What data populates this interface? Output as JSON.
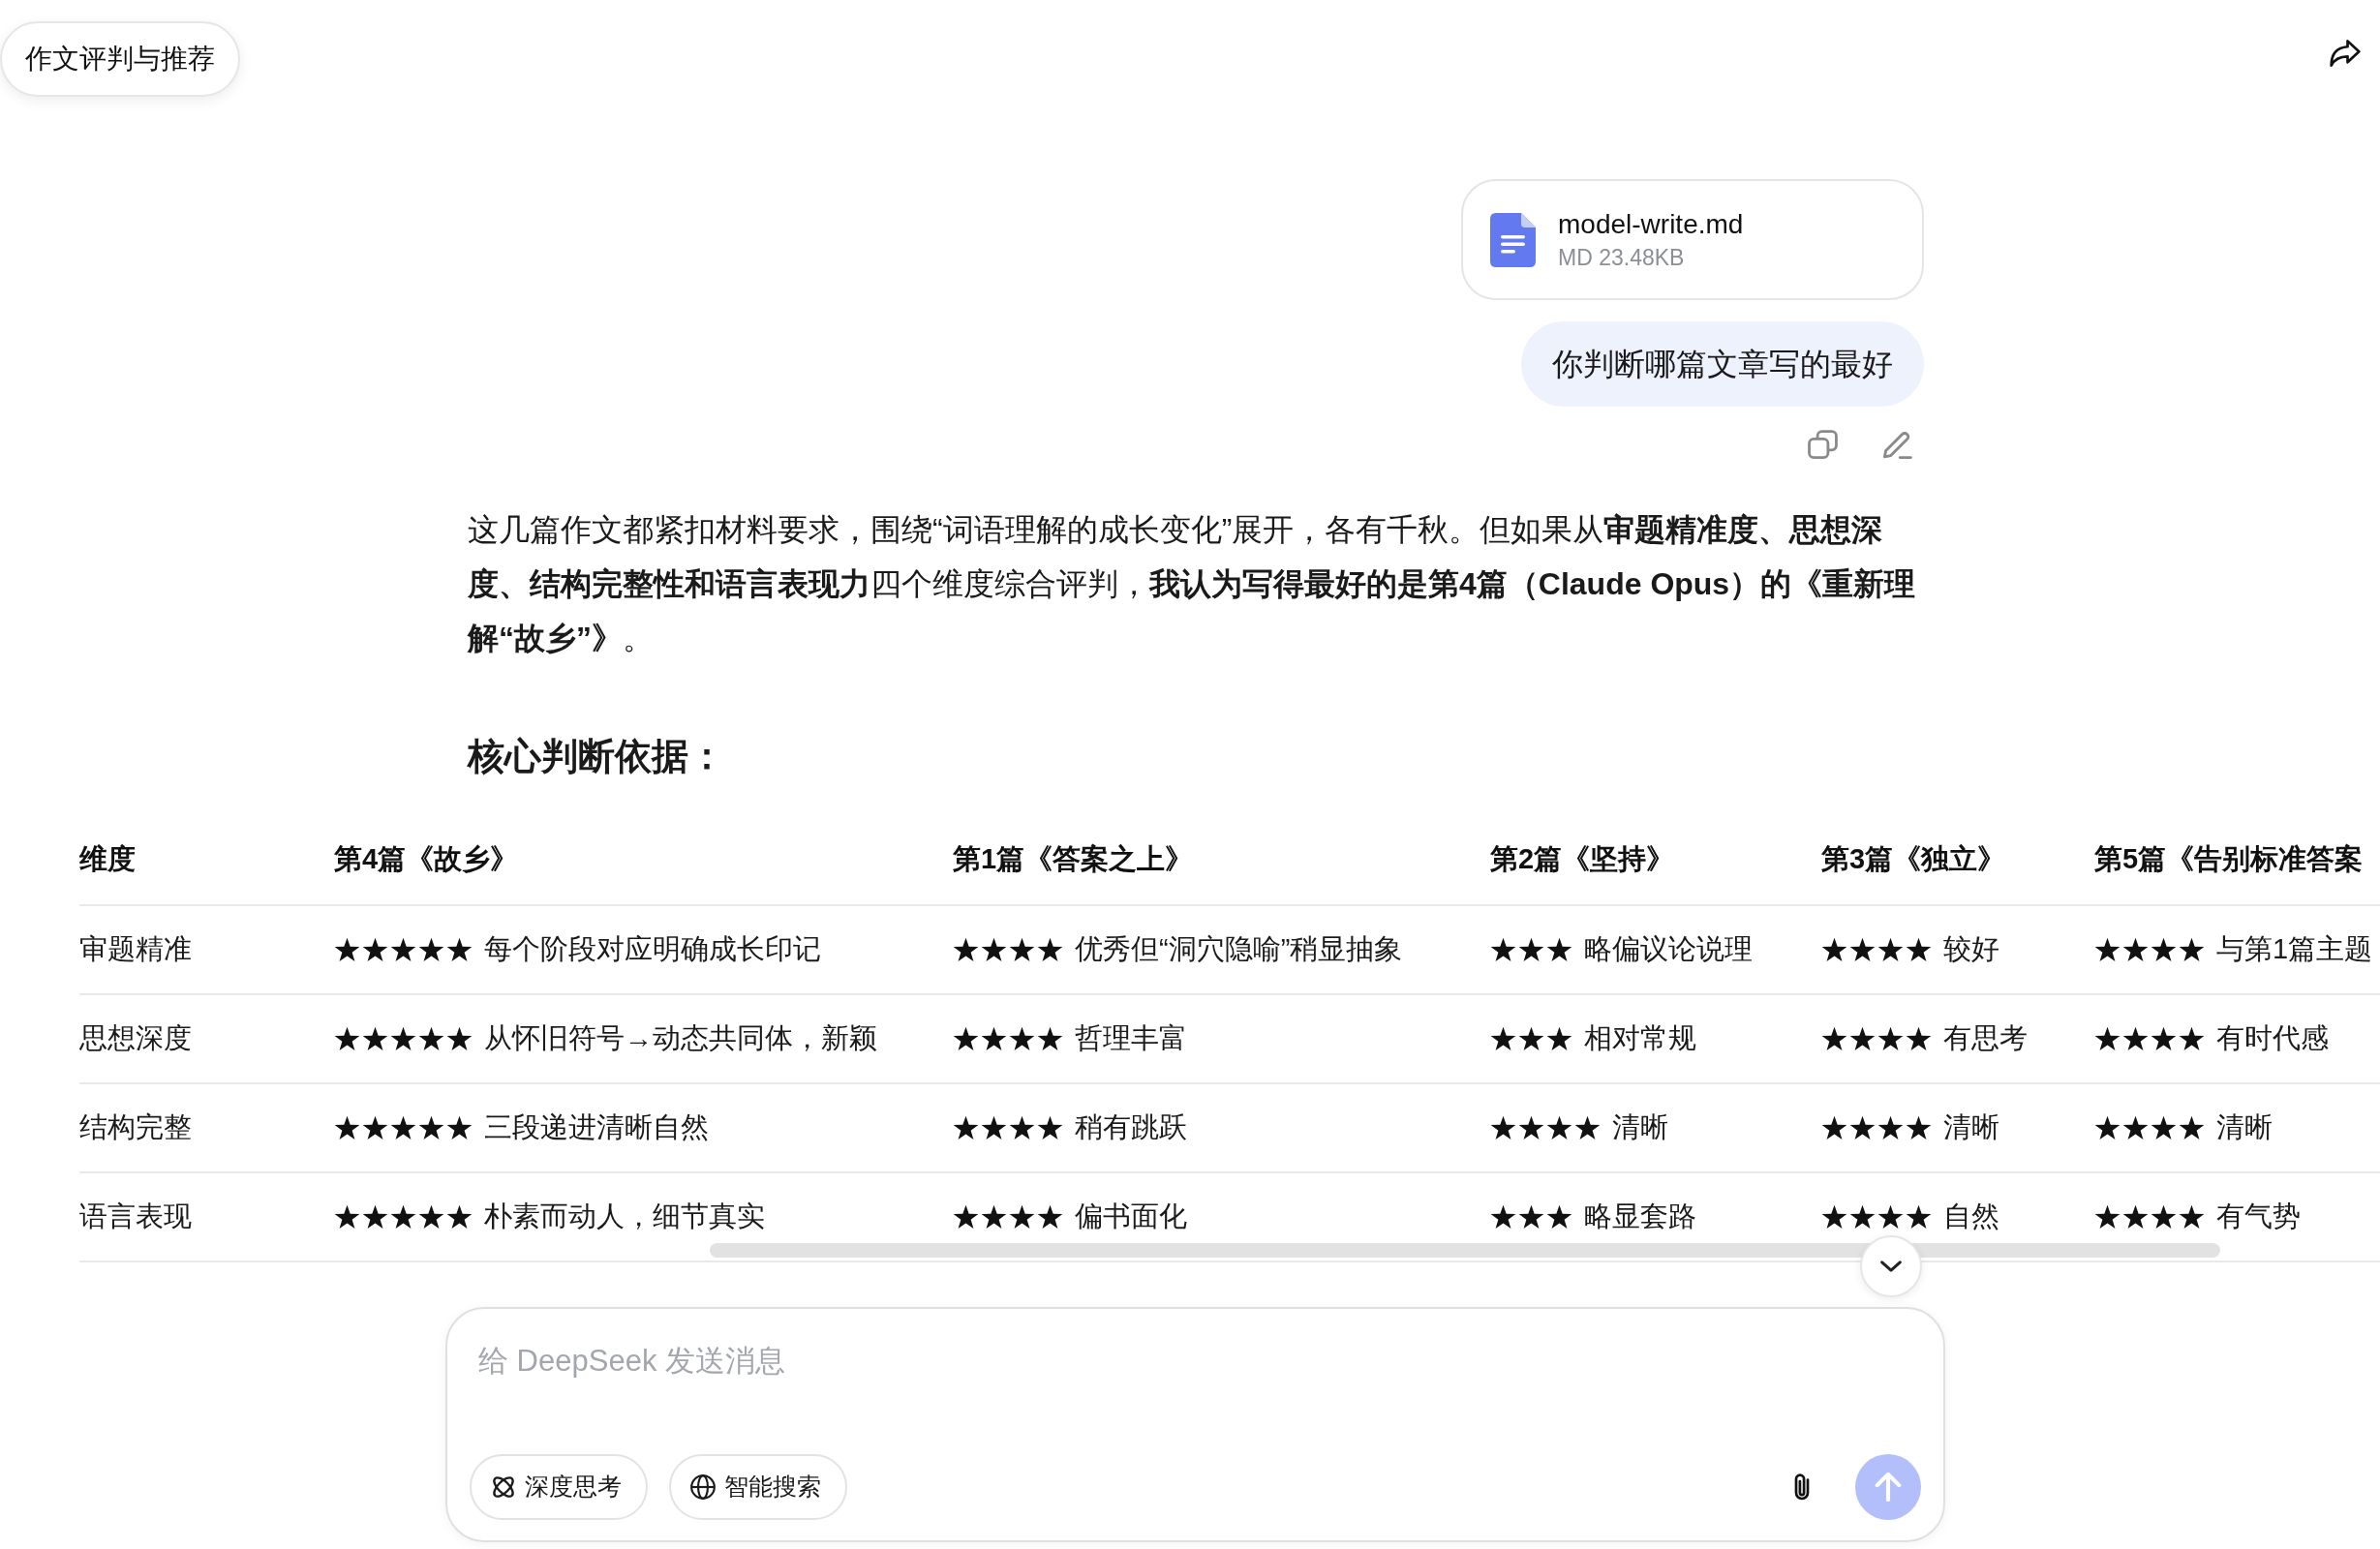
{
  "header": {
    "title": "作文评判与推荐"
  },
  "user_message": {
    "attachment": {
      "file_name": "model-write.md",
      "file_info": "MD 23.48KB"
    },
    "text": "你判断哪篇文章写的最好"
  },
  "assistant_message": {
    "paragraph": "这几篇作文都紧扣材料要求，围绕“词语理解的成长变化”展开，各有千秋。但如果从**审题精准度、思想深度、结构完整性和语言表现力**四个维度综合评判，**我认为写得最好的是第4篇（Claude Opus）的《重新理解“故乡”》**。",
    "heading": "核心判断依据：",
    "table": {
      "columns": [
        "维度",
        "第4篇《故乡》",
        "第1篇《答案之上》",
        "第2篇《坚持》",
        "第3篇《独立》",
        "第5篇《告别标准答案"
      ],
      "rows": [
        {
          "cells": [
            {
              "kind": "label",
              "text": "审题精准"
            },
            {
              "kind": "rating",
              "stars": 5,
              "text": "每个阶段对应明确成长印记"
            },
            {
              "kind": "rating",
              "stars": 4,
              "text": "优秀但“洞穴隐喻”稍显抽象"
            },
            {
              "kind": "rating",
              "stars": 3,
              "text": "略偏议论说理"
            },
            {
              "kind": "rating",
              "stars": 4,
              "text": "较好"
            },
            {
              "kind": "rating",
              "stars": 4,
              "text": "与第1篇主题"
            }
          ]
        },
        {
          "cells": [
            {
              "kind": "label",
              "text": "思想深度"
            },
            {
              "kind": "rating",
              "stars": 5,
              "text": "从怀旧符号→动态共同体，新颖"
            },
            {
              "kind": "rating",
              "stars": 4,
              "text": "哲理丰富"
            },
            {
              "kind": "rating",
              "stars": 3,
              "text": "相对常规"
            },
            {
              "kind": "rating",
              "stars": 4,
              "text": "有思考"
            },
            {
              "kind": "rating",
              "stars": 4,
              "text": "有时代感"
            }
          ]
        },
        {
          "cells": [
            {
              "kind": "label",
              "text": "结构完整"
            },
            {
              "kind": "rating",
              "stars": 5,
              "text": "三段递进清晰自然"
            },
            {
              "kind": "rating",
              "stars": 4,
              "text": "稍有跳跃"
            },
            {
              "kind": "rating",
              "stars": 4,
              "text": "清晰"
            },
            {
              "kind": "rating",
              "stars": 4,
              "text": "清晰"
            },
            {
              "kind": "rating",
              "stars": 4,
              "text": "清晰"
            }
          ]
        },
        {
          "cells": [
            {
              "kind": "label",
              "text": "语言表现"
            },
            {
              "kind": "rating",
              "stars": 5,
              "text": "朴素而动人，细节真实"
            },
            {
              "kind": "rating",
              "stars": 4,
              "text": "偏书面化"
            },
            {
              "kind": "rating",
              "stars": 3,
              "text": "略显套路"
            },
            {
              "kind": "rating",
              "stars": 4,
              "text": "自然"
            },
            {
              "kind": "rating",
              "stars": 4,
              "text": "有气势"
            }
          ]
        }
      ]
    }
  },
  "composer": {
    "placeholder": "给 DeepSeek 发送消息",
    "toggles": [
      {
        "label": "深度思考",
        "on": false
      },
      {
        "label": "智能搜索",
        "on": false
      }
    ],
    "send_button": {
      "disabled": true
    }
  }
}
